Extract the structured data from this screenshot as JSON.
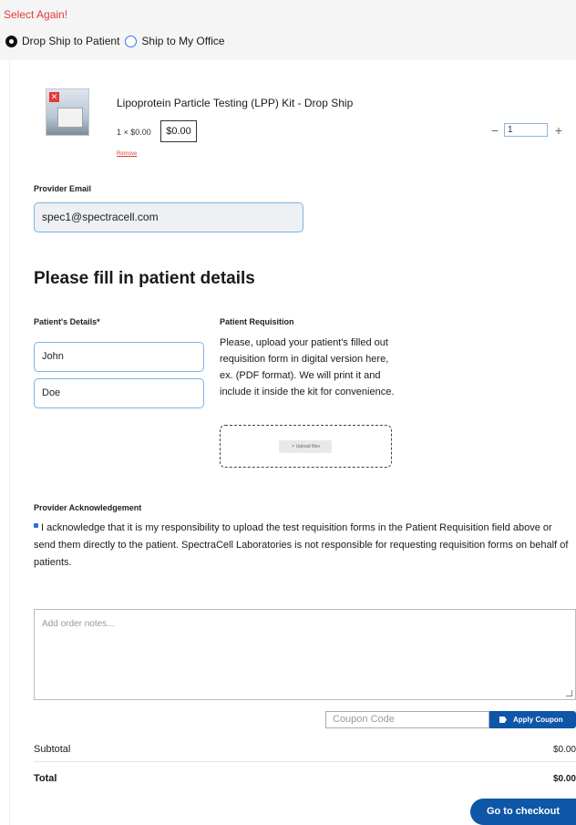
{
  "header": {
    "select_again": "Select Again!",
    "ship_options": [
      {
        "label": "Drop Ship to Patient",
        "checked": true
      },
      {
        "label": "Ship to My Office",
        "checked": false
      }
    ]
  },
  "product": {
    "name": "Lipoprotein Particle Testing (LPP) Kit - Drop Ship",
    "price_line": "1 × $0.00",
    "price_box": "$0.00",
    "remove": "Remove",
    "quantity": "1",
    "minus": "−",
    "plus": "+"
  },
  "provider": {
    "email_label": "Provider Email",
    "email_value": "spec1@spectracell.com"
  },
  "patient": {
    "section_title": "Please fill in patient details",
    "details_label": "Patient's Details*",
    "first_name": "John",
    "last_name": "Doe",
    "requisition_label": "Patient Requisition",
    "requisition_text": "Please, upload your patient's filled out requisition form in digital version here, ex. (PDF format). We will print it and include it inside the kit for convenience.",
    "upload_label": "↗ Upload files"
  },
  "acknowledgement": {
    "label": "Provider Acknowledgement",
    "text": "I acknowledge that it is my responsibility to upload the test requisition forms in the Patient Requisition field above or send them directly to the patient. SpectraCell Laboratories is not responsible for requesting requisition forms on behalf of patients."
  },
  "order": {
    "notes_placeholder": "Add order notes...",
    "coupon_placeholder": "Coupon Code",
    "apply_coupon": "Apply Coupon",
    "subtotal_label": "Subtotal",
    "subtotal_value": "$0.00",
    "total_label": "Total",
    "total_value": "$0.00",
    "checkout": "Go to checkout"
  },
  "colors": {
    "accent": "#0e56a8",
    "alert": "#e03c3c",
    "input_border": "#7ab3e8"
  }
}
